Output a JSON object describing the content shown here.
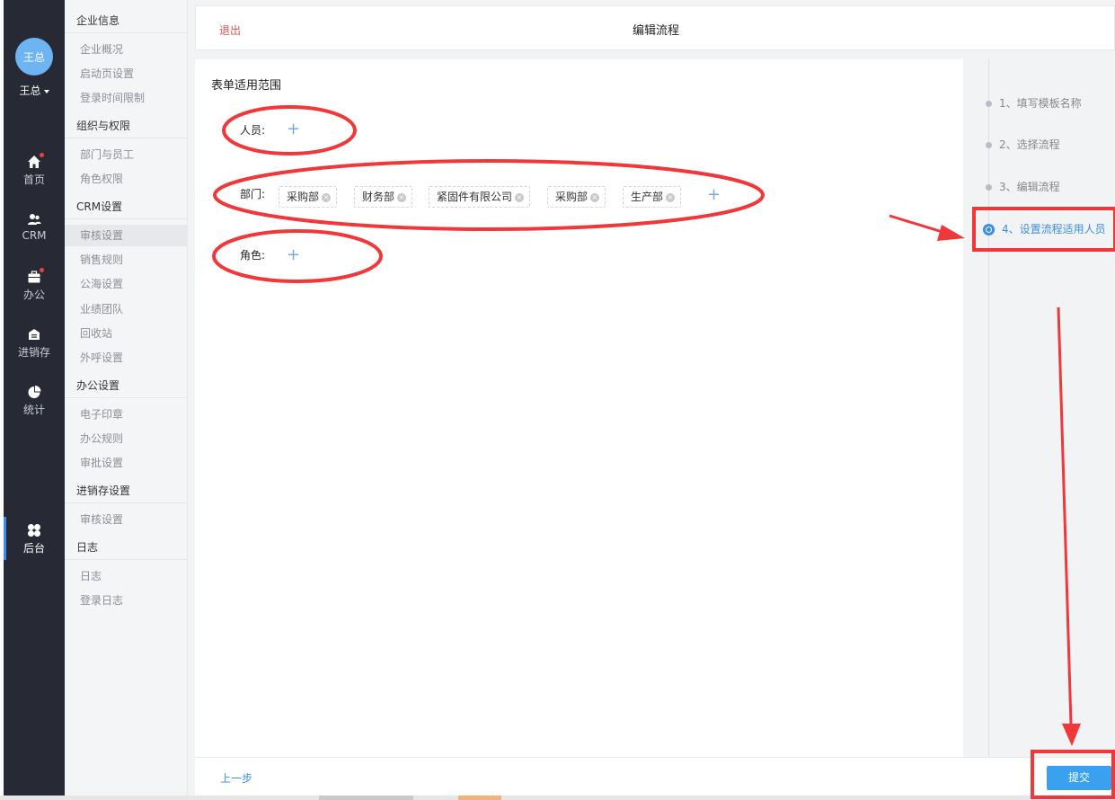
{
  "user": {
    "avatar_text": "王总",
    "name": "王总"
  },
  "leftnav": {
    "items": [
      {
        "label": "首页",
        "icon": "home-icon"
      },
      {
        "label": "CRM",
        "icon": "users-icon"
      },
      {
        "label": "办公",
        "icon": "briefcase-icon"
      },
      {
        "label": "进销存",
        "icon": "inventory-icon"
      },
      {
        "label": "统计",
        "icon": "pie-chart-icon"
      },
      {
        "label": "后台",
        "icon": "grid-icon"
      }
    ]
  },
  "submenu": {
    "groups": [
      {
        "title": "企业信息",
        "items": [
          "企业概况",
          "启动页设置",
          "登录时间限制"
        ]
      },
      {
        "title": "组织与权限",
        "items": [
          "部门与员工",
          "角色权限"
        ]
      },
      {
        "title": "CRM设置",
        "items": [
          "审核设置",
          "销售规则",
          "公海设置",
          "业绩团队",
          "回收站",
          "外呼设置"
        ]
      },
      {
        "title": "办公设置",
        "items": [
          "电子印章",
          "办公规则",
          "审批设置"
        ]
      },
      {
        "title": "进销存设置",
        "items": [
          "审核设置"
        ]
      },
      {
        "title": "日志",
        "items": [
          "日志",
          "登录日志"
        ]
      }
    ]
  },
  "topbar": {
    "exit_label": "退出",
    "title": "编辑流程"
  },
  "form": {
    "section_title": "表单适用范围",
    "person_label": "人员:",
    "dept_label": "部门:",
    "role_label": "角色:",
    "plus_symbol": "+",
    "departments": [
      "采购部",
      "财务部",
      "紧固件有限公司",
      "采购部",
      "生产部"
    ]
  },
  "steps": [
    "1、填写模板名称",
    "2、选择流程",
    "3、编辑流程",
    "4、设置流程适用人员"
  ],
  "footer": {
    "prev_label": "上一步",
    "submit_label": "提交"
  },
  "colors": {
    "accent": "#3a8ee6",
    "danger": "#e05050",
    "annotation": "#f0373a",
    "nav_bg": "#272a35"
  }
}
